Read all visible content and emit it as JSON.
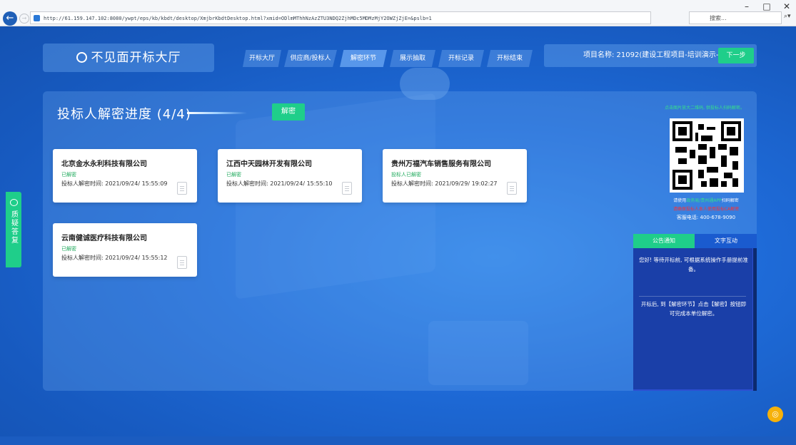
{
  "browser": {
    "url": "http://61.159.147.102:8080/ywpt/eps/kb/kbdt/desktop/XmjbrKbdtDesktop.html?xmid=ODlmMThhNzAzZTU3NDQ2ZjhMDc5MDMzMjY2OWZjZjE=&pslb=1",
    "search_placeholder": "搜索...",
    "back_icon": "back-arrow-icon",
    "refresh_label": "▾ C"
  },
  "header": {
    "brand": "不见面开标大厅",
    "tabs": [
      "开标大厅",
      "供应商/投标人",
      "解密环节",
      "展示抽取",
      "开标记录",
      "开标结束"
    ],
    "project_label": "项目名称: 21092(建设工程项目-培训演示-00",
    "next_button": "下一步"
  },
  "main": {
    "progress_title": "投标人解密进度",
    "progress_count": "(4/4)",
    "decrypt_button": "解密",
    "bidders": [
      {
        "name": "北京金水永利科技有限公司",
        "status": "已解密",
        "time": "投标人解密时间: 2021/09/24/ 15:55:09"
      },
      {
        "name": "江西中天园林开发有限公司",
        "status": "已解密",
        "time": "投标人解密时间: 2021/09/24/ 15:55:10"
      },
      {
        "name": "贵州万福汽车销售服务有限公司",
        "status": "投标人已解密",
        "time": "投标人解密时间: 2021/09/29/ 19:02:27"
      },
      {
        "name": "云南健诚医疗科技有限公司",
        "status": "已解密",
        "time": "投标人解密时间: 2021/09/24/ 15:55:12"
      }
    ]
  },
  "side_tab": {
    "label": "质疑答复"
  },
  "sidebar": {
    "qr_hint": "点击图片放大二维码, 供投标人扫码解密。",
    "qr_usage_prefix": "请使用",
    "qr_usage_app": "政务易/贵州通APP",
    "qr_usage_suffix": "扫码解密",
    "qr_warning": "请确保投标人本人使用投标CA解密",
    "service_phone": "客服电话: 400-678-9090",
    "notice_tabs": [
      "公告通知",
      "文字互动"
    ],
    "notices": [
      "您好! 等待开标前, 可根据系统操作手册提前准备。",
      "开标后, 到【解密环节】点击【解密】按钮即可完成本单位解密。"
    ]
  },
  "colors": {
    "accent_green": "#1fce8a",
    "background_blue": "#1b63c9",
    "notice_panel": "#1a3fa8",
    "help_bubble": "#f6b10a"
  }
}
